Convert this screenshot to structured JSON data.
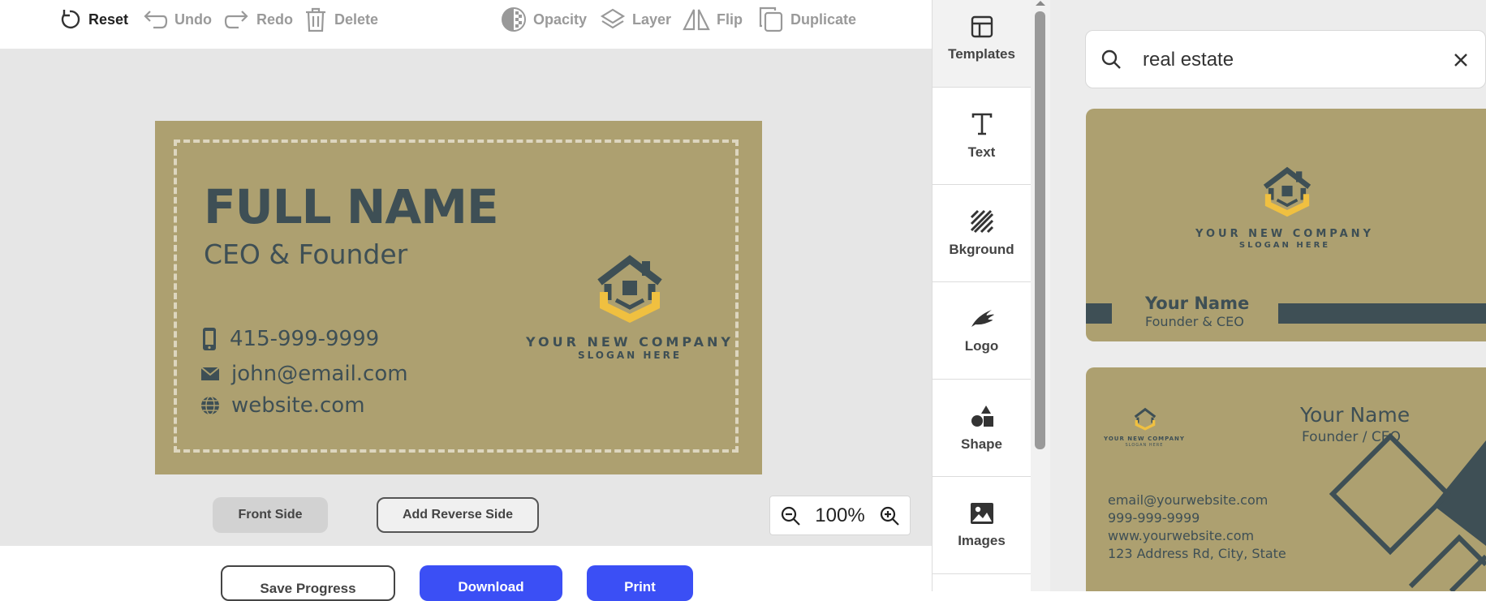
{
  "toolbar": {
    "reset": "Reset",
    "undo": "Undo",
    "redo": "Redo",
    "delete": "Delete",
    "opacity": "Opacity",
    "layer": "Layer",
    "flip": "Flip",
    "duplicate": "Duplicate"
  },
  "card": {
    "name": "FULL NAME",
    "title": "CEO & Founder",
    "phone": "415-999-9999",
    "email": "john@email.com",
    "website": "website.com",
    "company": "YOUR NEW COMPANY",
    "slogan": "SLOGAN HERE",
    "background_color": "#ada070",
    "text_color": "#3e4f55",
    "logo_accent": "#f0c040"
  },
  "sides": {
    "front": "Front Side",
    "add_reverse": "Add Reverse Side"
  },
  "zoom": {
    "value": "100%"
  },
  "actions": {
    "save": "Save Progress",
    "download": "Download",
    "print": "Print",
    "primary_color": "#3b4ff5"
  },
  "sidebar": {
    "items": [
      {
        "label": "Templates",
        "icon": "templates-icon"
      },
      {
        "label": "Text",
        "icon": "text-icon"
      },
      {
        "label": "Bkground",
        "icon": "background-icon"
      },
      {
        "label": "Logo",
        "icon": "logo-icon"
      },
      {
        "label": "Shape",
        "icon": "shape-icon"
      },
      {
        "label": "Images",
        "icon": "images-icon"
      }
    ]
  },
  "search": {
    "value": "real estate"
  },
  "templates": [
    {
      "company": "YOUR NEW COMPANY",
      "slogan": "SLOGAN HERE",
      "name": "Your Name",
      "role": "Founder & CEO"
    },
    {
      "company": "YOUR NEW COMPANY",
      "slogan": "SLOGAN HERE",
      "name": "Your Name",
      "role": "Founder / CEO",
      "email": "email@yourwebsite.com",
      "phone": "999-999-9999",
      "website": "www.yourwebsite.com",
      "address": "123 Address Rd, City, State"
    }
  ]
}
